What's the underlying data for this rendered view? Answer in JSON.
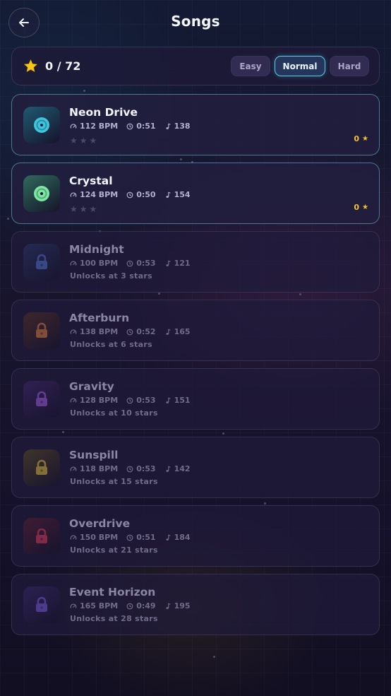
{
  "header": {
    "title": "Songs"
  },
  "stats": {
    "stars_text": "0 / 72"
  },
  "difficulties": [
    {
      "label": "Easy",
      "active": false
    },
    {
      "label": "Normal",
      "active": true
    },
    {
      "label": "Hard",
      "active": false
    }
  ],
  "songs": [
    {
      "title": "Neon Drive",
      "bpm": "112 BPM",
      "duration": "0:51",
      "notes": "138",
      "locked": false,
      "stars_earned": "0",
      "star_rating": 0,
      "color": "#3ec6e0",
      "cover_bg": "#1f5a72"
    },
    {
      "title": "Crystal",
      "bpm": "124 BPM",
      "duration": "0:50",
      "notes": "154",
      "locked": false,
      "stars_earned": "0",
      "star_rating": 0,
      "color": "#7de6a3",
      "cover_bg": "#2f6a5c"
    },
    {
      "title": "Midnight",
      "bpm": "100 BPM",
      "duration": "0:53",
      "notes": "121",
      "locked": true,
      "unlock_text": "Unlocks at 3 stars",
      "color": "#4f6fc8",
      "cover_bg": "#2c3868"
    },
    {
      "title": "Afterburn",
      "bpm": "138 BPM",
      "duration": "0:52",
      "notes": "165",
      "locked": true,
      "unlock_text": "Unlocks at 6 stars",
      "color": "#d47a3a",
      "cover_bg": "#5a3222"
    },
    {
      "title": "Gravity",
      "bpm": "128 BPM",
      "duration": "0:53",
      "notes": "151",
      "locked": true,
      "unlock_text": "Unlocks at 10 stars",
      "color": "#9a5ad8",
      "cover_bg": "#43276c"
    },
    {
      "title": "Sunspill",
      "bpm": "118 BPM",
      "duration": "0:53",
      "notes": "142",
      "locked": true,
      "unlock_text": "Unlocks at 15 stars",
      "color": "#d8b83a",
      "cover_bg": "#5c4c20"
    },
    {
      "title": "Overdrive",
      "bpm": "150 BPM",
      "duration": "0:51",
      "notes": "184",
      "locked": true,
      "unlock_text": "Unlocks at 21 stars",
      "color": "#d83a5a",
      "cover_bg": "#5c2032"
    },
    {
      "title": "Event Horizon",
      "bpm": "165 BPM",
      "duration": "0:49",
      "notes": "195",
      "locked": true,
      "unlock_text": "Unlocks at 28 stars",
      "color": "#7a5ad8",
      "cover_bg": "#3a2a6a"
    }
  ],
  "colors": {
    "accent": "#5bd1e8",
    "star": "#f1c232"
  }
}
